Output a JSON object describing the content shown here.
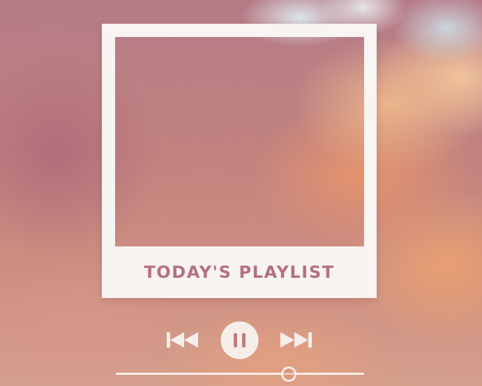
{
  "playlist": {
    "title": "TODAY'S PLAYLIST"
  },
  "player": {
    "state": "playing",
    "progress_fraction": 0.695,
    "icons": {
      "previous": "skip-previous-icon",
      "pause": "pause-icon",
      "next": "skip-next-icon"
    }
  },
  "colors": {
    "frame": "#f8f4f1",
    "title_text": "#b46f85",
    "controls": "#f6eeea",
    "sky_mauve": "#b67b87",
    "cloud_orange": "#ec966a"
  }
}
